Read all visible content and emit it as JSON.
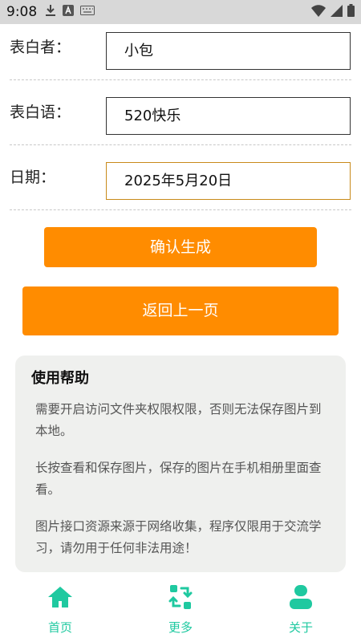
{
  "status_bar": {
    "time": "9:08",
    "icons": [
      "download-icon",
      "a-icon",
      "keyboard-icon",
      "wifi-icon",
      "signal-icon",
      "battery-icon"
    ]
  },
  "form": {
    "confessor": {
      "label": "表白者：",
      "value": "小包"
    },
    "message": {
      "label": "表白语：",
      "value": "520快乐"
    },
    "date": {
      "label": "日期：",
      "value": "2025年5月20日"
    }
  },
  "buttons": {
    "confirm": "确认生成",
    "back": "返回上一页"
  },
  "help": {
    "title": "使用帮助",
    "paragraphs": [
      "需要开启访问文件夹权限权限，否则无法保存图片到本地。",
      "长按查看和保存图片，保存的图片在手机相册里面查看。",
      "图片接口资源来源于网络收集，程序仅限用于交流学习，请勿用于任何非法用途！"
    ]
  },
  "tabs": [
    {
      "label": "首页",
      "icon": "home-icon"
    },
    {
      "label": "更多",
      "icon": "swap-icon"
    },
    {
      "label": "关于",
      "icon": "user-icon"
    }
  ],
  "colors": {
    "accent": "#ff8c00",
    "tab_active": "#1fc9a0",
    "card_bg": "#eff0ee"
  }
}
